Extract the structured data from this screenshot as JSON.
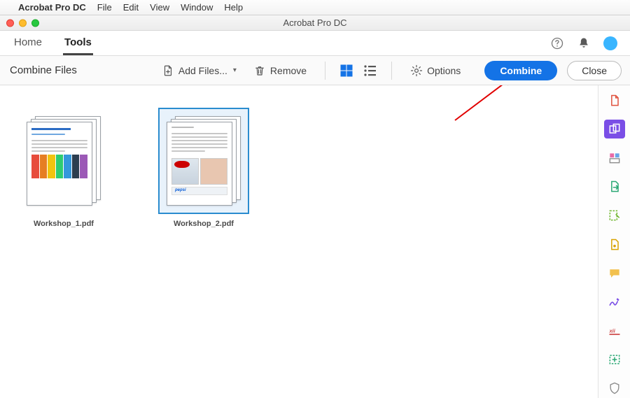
{
  "menubar": {
    "app_name": "Acrobat Pro DC",
    "items": [
      "File",
      "Edit",
      "View",
      "Window",
      "Help"
    ]
  },
  "window": {
    "title": "Acrobat Pro DC"
  },
  "nav": {
    "home": "Home",
    "tools": "Tools",
    "active": "Tools",
    "right_icons": [
      "help-icon",
      "bell-icon",
      "avatar-icon"
    ]
  },
  "toolbar": {
    "section_title": "Combine Files",
    "add_files": "Add Files...",
    "remove": "Remove",
    "options": "Options",
    "combine": "Combine",
    "close": "Close",
    "view_mode": "grid"
  },
  "files": [
    {
      "name": "Workshop_1.pdf",
      "selected": false
    },
    {
      "name": "Workshop_2.pdf",
      "selected": true
    }
  ],
  "rail_icons": [
    "create-pdf-icon",
    "combine-files-icon",
    "organize-pages-icon",
    "export-pdf-icon",
    "edit-pdf-icon",
    "protect-icon",
    "comment-icon",
    "fill-sign-icon",
    "redact-icon",
    "more-tools-icon",
    "shield-icon"
  ],
  "rail_active_index": 1,
  "colors": {
    "primary": "#1473e6",
    "rail_active": "#7a4ee6"
  }
}
